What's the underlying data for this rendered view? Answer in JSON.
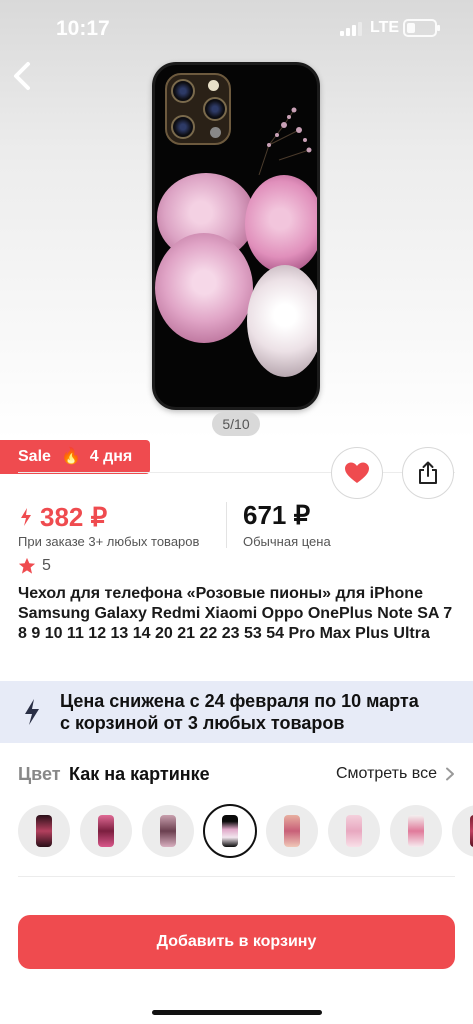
{
  "status_bar": {
    "time": "10:17",
    "network": "LTE"
  },
  "gallery": {
    "counter": "5/10",
    "current": 5,
    "total": 10
  },
  "sale": {
    "label": "Sale",
    "emoji": "🔥",
    "days": "4 дня"
  },
  "prices": {
    "sale_price": "382 ₽",
    "sale_note": "При заказе 3+ любых товаров",
    "normal_price": "671 ₽",
    "normal_note": "Обычная цена",
    "accent_color": "#ef4b4f"
  },
  "rating": {
    "value": "5"
  },
  "product": {
    "title": "Чехол для телефона «Розовые пионы» для iPhone Samsung Galaxy Redmi Xiaomi Oppo OnePlus Note SA 7 8 9 10 11 12 13 14 20 21 22 23 53 54 Pro Max Plus Ultra"
  },
  "promo": {
    "line1": "Цена снижена с 24 февраля по 10 марта",
    "line2": "с корзиной от 3 любых товаров"
  },
  "color": {
    "label": "Цвет",
    "value": "Как на картинке",
    "see_all": "Смотреть все",
    "selected_index": 3
  },
  "cart": {
    "button_label": "Добавить в корзину"
  },
  "icons": {
    "back": "chevron-left-icon",
    "favorite": "heart-icon",
    "share": "share-icon",
    "price_bolt": "lightning-icon",
    "star": "star-icon",
    "see_all": "chevron-right-icon"
  }
}
